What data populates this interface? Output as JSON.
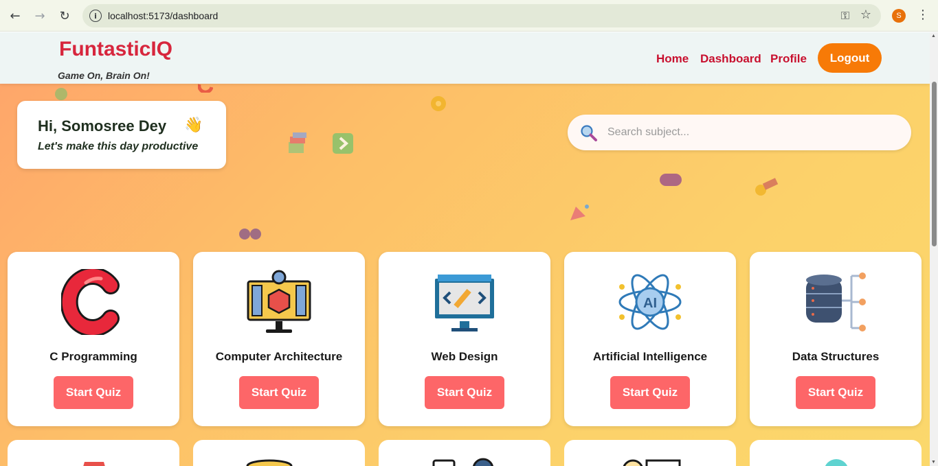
{
  "browser": {
    "url": "localhost:5173/dashboard",
    "profile_initial": "S",
    "icons": [
      "back-arrow-icon",
      "forward-arrow-icon",
      "reload-icon",
      "info-icon",
      "key-icon",
      "star-icon",
      "more-menu-icon"
    ]
  },
  "header": {
    "brand": "FuntasticIQ",
    "tagline": "Game On, Brain On!",
    "nav": [
      "Home",
      "Dashboard",
      "Profile"
    ],
    "logout_label": "Logout"
  },
  "greeting": {
    "title": "Hi, Somosree Dey",
    "wave_emoji": "👋",
    "subtitle": "Let's make this day productive"
  },
  "search": {
    "placeholder": "Search subject..."
  },
  "subjects": [
    {
      "title": "C Programming",
      "button": "Start Quiz",
      "icon": "c-letter-icon"
    },
    {
      "title": "Computer Architecture",
      "button": "Start Quiz",
      "icon": "computer-architecture-icon"
    },
    {
      "title": "Web Design",
      "button": "Start Quiz",
      "icon": "web-design-icon"
    },
    {
      "title": "Artificial Intelligence",
      "button": "Start Quiz",
      "icon": "ai-atom-icon"
    },
    {
      "title": "Data Structures",
      "button": "Start Quiz",
      "icon": "database-tree-icon"
    }
  ],
  "colors": {
    "brand": "#d7263d",
    "nav_link": "#c8102e",
    "logout": "#f77a07",
    "quiz_button": "#fd6668"
  }
}
